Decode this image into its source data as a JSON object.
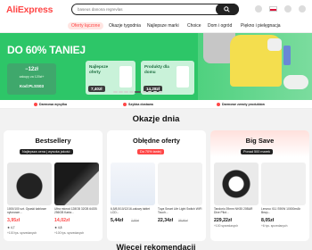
{
  "header": {
    "logo": "AliExpress",
    "search_placeholder": "baseus danona regrevlas"
  },
  "nav": {
    "items": [
      "Oferty łączone",
      "Okazje tygodnia",
      "Najlepsze marki",
      "Choice",
      "Dom i ogród",
      "Piękno i pielęgnacja"
    ]
  },
  "hero": {
    "title": "DO 60% TANIEJ",
    "coupon": {
      "amount": "−12zł",
      "subtitle": "zakupy za 120zł+",
      "code": "Kod:PLSS03"
    },
    "deals": [
      {
        "label": "Najlepsze oferty",
        "price": "7,40zł"
      },
      {
        "label": "Produkty dla domu",
        "price": "14,28zł"
      }
    ],
    "slides_total": 9,
    "slide_active": 4
  },
  "trust": [
    "Darmowa wysyłka",
    "Szybka dostawa",
    "Darmowe zwroty produktów"
  ],
  "deals_title": "Okazje dnia",
  "cards": [
    {
      "title": "Bestsellery",
      "badge": "Najlepsza cena | wysoka jakość",
      "products": [
        {
          "name": "1000/100 szt. Opaski kablowe nylonowe...",
          "price": "3,95zł",
          "old": "",
          "rating": "★ 4,7",
          "sold": "+100 tys. sprzedanych"
        },
        {
          "name": "Ultra microd 128GB 32GB 64GB 256GB Karta...",
          "price": "14,02zł",
          "old": "",
          "rating": "★ 4,8",
          "sold": "+100 tys. sprzedanych"
        }
      ]
    },
    {
      "title": "Obłędne oferty",
      "badge": "Do 70% taniej",
      "products": [
        {
          "name": "6,5/8,5/10/12/16-calowy tablet LCD...",
          "price": "5,44zł",
          "old": "7,93zł",
          "rating": "",
          "sold": ""
        },
        {
          "name": "Tuya Smart Life Light Switch WiFi Touch...",
          "price": "22,34zł",
          "old": "38,46zł",
          "rating": "",
          "sold": ""
        }
      ]
    },
    {
      "title": "Big Save",
      "badge": "Ponad 500 marek",
      "products": [
        {
          "name": "Tandorio 39mm NH35 20BAR Dive Pilot...",
          "price": "229,22zł",
          "old": "",
          "rating": "",
          "sold": "+100 sprzedanych"
        },
        {
          "name": "Lenovo X11 S90W 10000mAh Bezp...",
          "price": "8,05zł",
          "old": "",
          "rating": "",
          "sold": "+6 tys. sprzedanych"
        }
      ]
    }
  ],
  "recommendations_title": "Więcej rekomendacji",
  "colors": {
    "brand": "#ff4747",
    "hero": "#2dc668"
  }
}
